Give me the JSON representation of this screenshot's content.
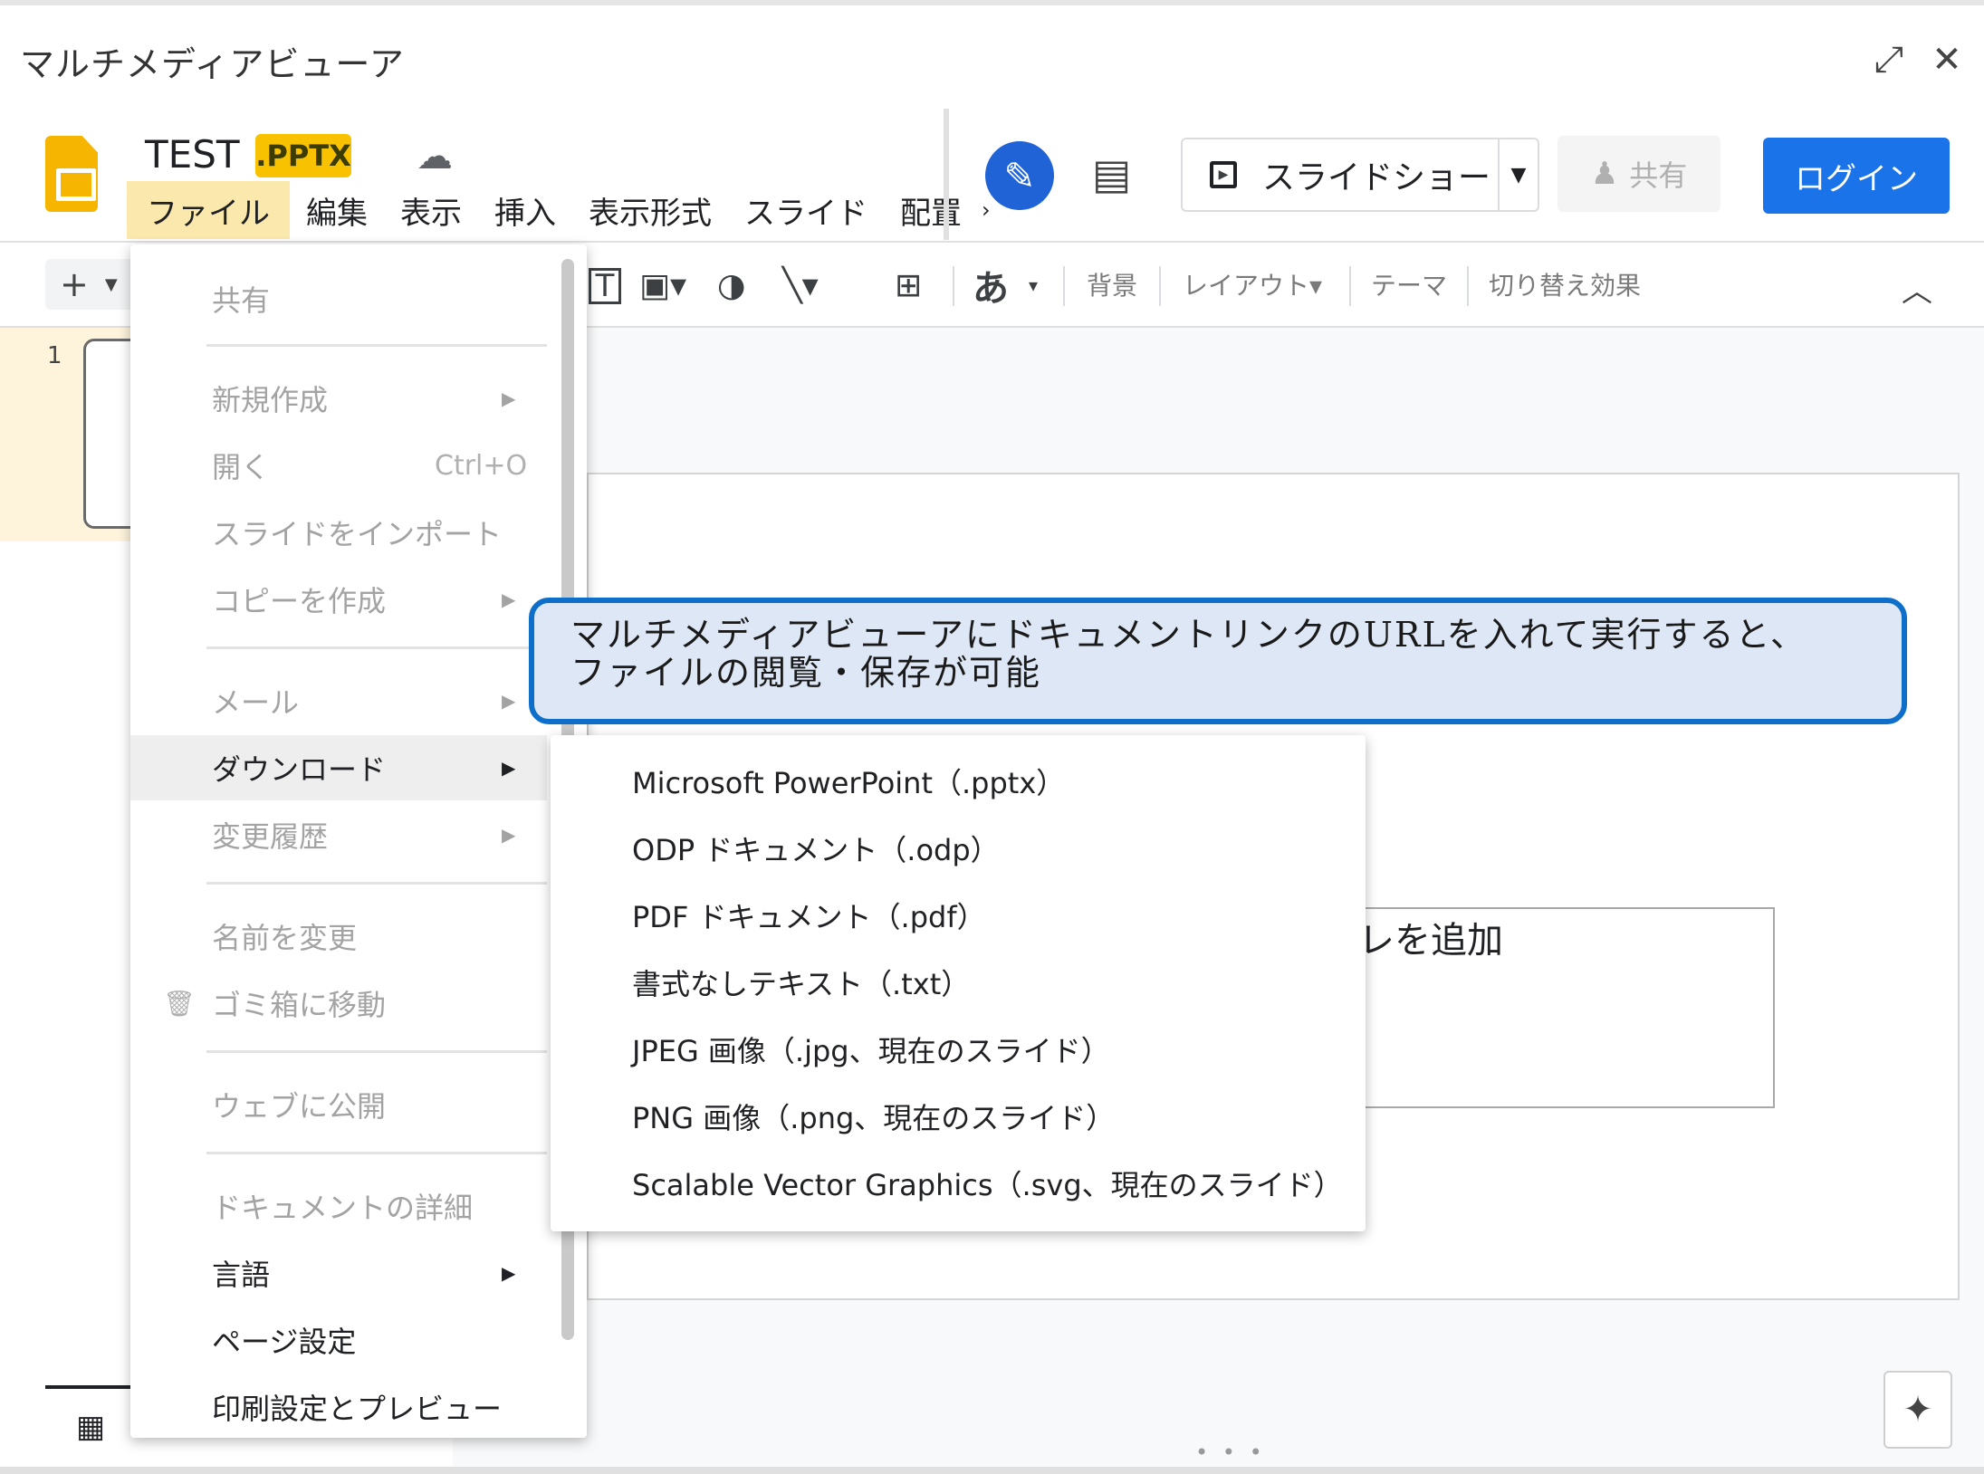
{
  "window": {
    "title": "マルチメディアビューア",
    "restore_icon": "⤢",
    "close_icon": "✕"
  },
  "header": {
    "doc_title": "TEST",
    "ext_badge": ".PPTX",
    "cloud_icon": "☁",
    "menus": [
      "ファイル",
      "編集",
      "表示",
      "挿入",
      "表示形式",
      "スライド",
      "配置"
    ],
    "more_marker": "›",
    "extension_glyph": "✎",
    "comment_glyph": "▤",
    "slideshow_label": "スライドショー",
    "slideshow_play_glyph": "▶",
    "slideshow_arrow": "▼",
    "share_glyph": "♟",
    "share_label": "共有",
    "login_label": "ログイン"
  },
  "toolbar": {
    "add": "+",
    "add_arrow": "▼",
    "textbox_glyph": "T",
    "image_glyph": "▣▾",
    "shape_glyph": "◑",
    "line_glyph": "╲▾",
    "comment_add_glyph": "⊞",
    "font_char": "あ",
    "font_arrow": "▾",
    "background": "背景",
    "layout": "レイアウト▾",
    "theme": "テーマ",
    "transition": "切り替え効果",
    "collapse_glyph": "︿"
  },
  "filmstrip": {
    "slide_number": "1",
    "grid_glyph": "▦"
  },
  "slide": {
    "textbox_visible_text": "レを追加"
  },
  "file_menu": {
    "items": [
      {
        "label": "共有"
      },
      {
        "label": "新規作成",
        "submenu": "▶"
      },
      {
        "label": "開く",
        "shortcut": "Ctrl+O"
      },
      {
        "label": "スライドをインポート"
      },
      {
        "label": "コピーを作成",
        "submenu": "▶"
      },
      {
        "label": "メール",
        "submenu": "▶"
      },
      {
        "label": "ダウンロード",
        "submenu": "▶"
      },
      {
        "label": "変更履歴",
        "submenu": "▶"
      },
      {
        "label": "名前を変更"
      },
      {
        "label": "ゴミ箱に移動",
        "lead_icon": "🗑"
      },
      {
        "label": "ウェブに公開"
      },
      {
        "label": "ドキュメントの詳細"
      },
      {
        "label": "言語",
        "submenu": "▶"
      },
      {
        "label": "ページ設定"
      },
      {
        "label": "印刷設定とプレビュー"
      }
    ]
  },
  "download_menu": {
    "items": [
      "Microsoft PowerPoint（.pptx）",
      "ODP ドキュメント（.odp）",
      "PDF ドキュメント（.pdf）",
      "書式なしテキスト（.txt）",
      "JPEG 画像（.jpg、現在のスライド）",
      "PNG 画像（.png、現在のスライド）",
      "Scalable Vector Graphics（.svg、現在のスライド）"
    ]
  },
  "callout": {
    "line1": "マルチメディアビューアにドキュメントリンクのURLを入れて実行すると、",
    "line2": "ファイルの閲覧・保存が可能"
  },
  "colors": {
    "accent": "#1a73e8",
    "active_menu_bg": "#fbe8ad",
    "callout_border": "#0d6fc9",
    "callout_bg": "#dde7f5"
  }
}
